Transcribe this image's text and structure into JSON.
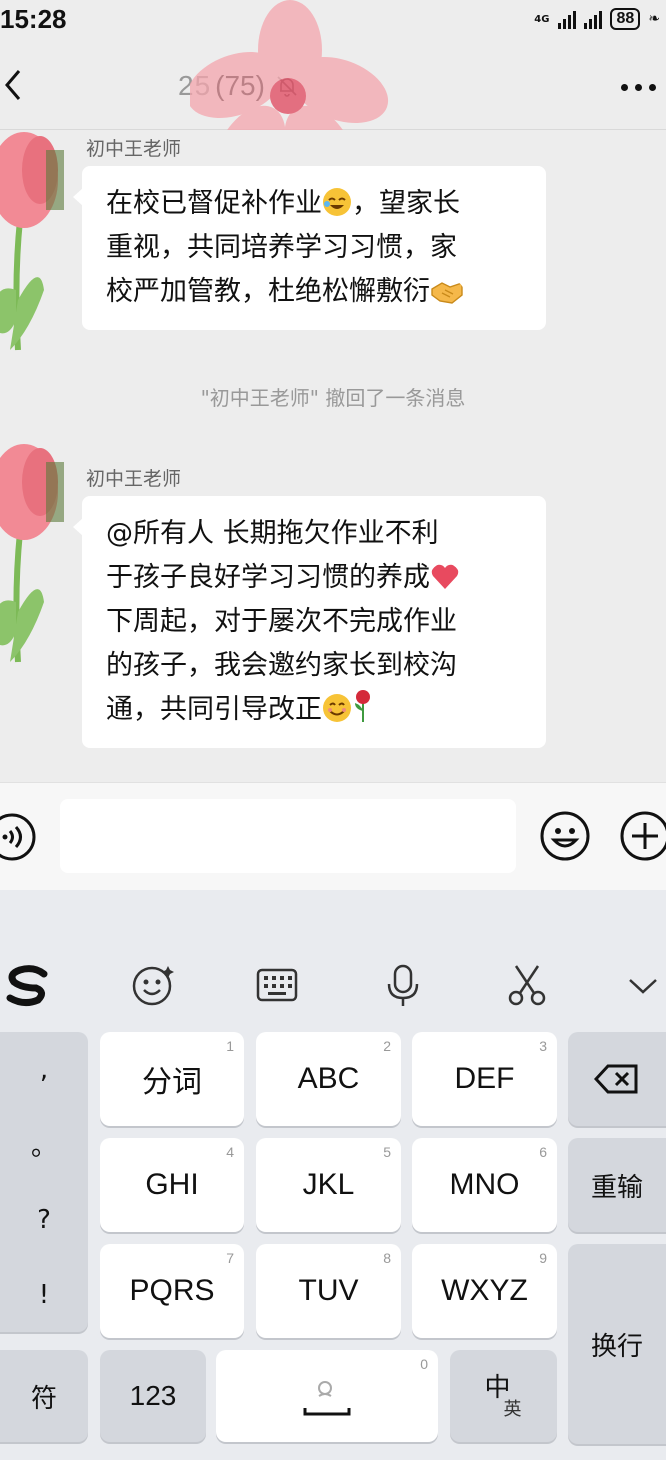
{
  "status_bar": {
    "time": "15:28",
    "network": "4G",
    "battery": "88"
  },
  "header": {
    "group_name_obscured": "25",
    "member_count": "(75)"
  },
  "messages": [
    {
      "sender": "初中王老师",
      "text_lines": [
        "在校已督促补作业",
        "，望家长",
        "重视，共同培养学习习惯，家",
        "校严加管教，杜绝松懈敷衍"
      ]
    },
    {
      "system": "\"初中王老师\" 撤回了一条消息"
    },
    {
      "sender": "初中王老师",
      "text_lines": [
        "@所有人 长期拖欠作业不利",
        "于孩子良好学习习惯的养成",
        "下周起，对于屡次不完成作业",
        "的孩子，我会邀约家长到校沟",
        "通，共同引导改正"
      ]
    }
  ],
  "keyboard": {
    "keys": {
      "fenci": "分词",
      "abc": "ABC",
      "def": "DEF",
      "ghi": "GHI",
      "jkl": "JKL",
      "mno": "MNO",
      "pqrs": "PQRS",
      "tuv": "TUV",
      "wxyz": "WXYZ",
      "n1": "1",
      "n2": "2",
      "n3": "3",
      "n4": "4",
      "n5": "5",
      "n6": "6",
      "n7": "7",
      "n8": "8",
      "n9": "9",
      "n0": "0"
    },
    "punct": [
      ",",
      "。",
      "?",
      "!"
    ],
    "retype": "重输",
    "enter": "换行",
    "symbols": "符",
    "num_key": "123",
    "lang_main": "中",
    "lang_sub": "英"
  }
}
